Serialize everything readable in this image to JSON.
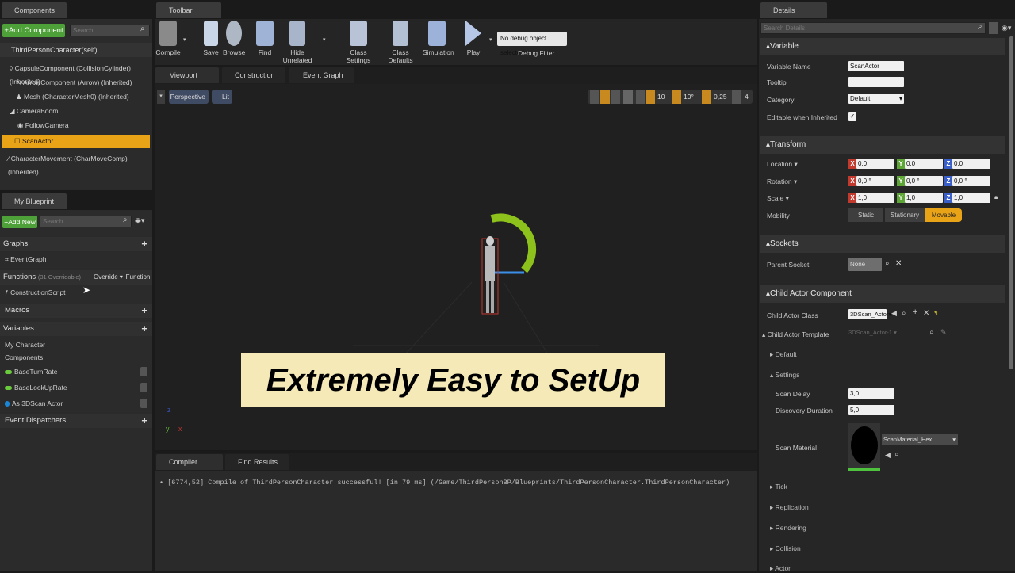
{
  "components": {
    "tab": "Components",
    "add_button": "+Add Component",
    "search_placeholder": "Search",
    "self_label": "ThirdPersonCharacter(self)",
    "items": [
      "CapsuleComponent (CollisionCylinder) (Inherited)",
      "ArrowComponent (Arrow) (Inherited)",
      "Mesh (CharacterMesh0) (Inherited)",
      "CameraBoom",
      "FollowCamera",
      "ScanActor",
      "CharacterMovement (CharMoveComp) (Inherited)"
    ]
  },
  "blueprint": {
    "tab": "My Blueprint",
    "add_new": "+Add New",
    "search_placeholder": "Search",
    "graphs": "Graphs",
    "event_graph": "EventGraph",
    "functions": "Functions",
    "functions_note": "(31 Overridable)",
    "override": "Override",
    "add_function": "+Function",
    "construction_script": "ConstructionScript",
    "macros": "Macros",
    "variables": "Variables",
    "my_character": "My Character",
    "components": "Components",
    "var_items": [
      "BaseTurnRate",
      "BaseLookUpRate",
      "As 3DScan Actor"
    ],
    "event_dispatchers": "Event Dispatchers"
  },
  "toolbar": {
    "tab": "Toolbar",
    "buttons": [
      "Compile",
      "Save",
      "Browse",
      "Find",
      "Hide Unrelated",
      "Class Settings",
      "Class Defaults",
      "Simulation",
      "Play"
    ],
    "debug_select": "No debug object selected",
    "debug_filter": "Debug Filter"
  },
  "editor_tabs": [
    "Viewport",
    "Construction Script",
    "Event Graph"
  ],
  "viewport": {
    "perspective": "Perspective",
    "lit": "Lit",
    "grid_snap": "10",
    "rot_snap": "10°",
    "scale_snap": "0,25",
    "cam_speed": "4",
    "overlay": "Extremely Easy to SetUp"
  },
  "results": {
    "tabs": [
      "Compiler Results",
      "Find Results"
    ],
    "log": "[6774,52] Compile of ThirdPersonCharacter successful! [in 79 ms] (/Game/ThirdPersonBP/Blueprints/ThirdPersonCharacter.ThirdPersonCharacter)"
  },
  "details": {
    "tab": "Details",
    "search_placeholder": "Search Details",
    "variable_section": "Variable",
    "variable_name_label": "Variable Name",
    "variable_name": "ScanActor",
    "tooltip_label": "Tooltip",
    "category_label": "Category",
    "category": "Default",
    "editable_label": "Editable when Inherited",
    "transform_section": "Transform",
    "location_label": "Location",
    "rotation_label": "Rotation",
    "scale_label": "Scale",
    "location": [
      "0,0",
      "0,0",
      "0,0"
    ],
    "rotation": [
      "0,0 °",
      "0,0 °",
      "0,0 °"
    ],
    "scale": [
      "1,0",
      "1,0",
      "1,0"
    ],
    "mobility_label": "Mobility",
    "mobility_options": [
      "Static",
      "Stationary",
      "Movable"
    ],
    "sockets_section": "Sockets",
    "parent_socket_label": "Parent Socket",
    "parent_socket": "None",
    "child_actor_section": "Child Actor Component",
    "child_actor_class_label": "Child Actor Class",
    "child_actor_class": "3DScan_Actor",
    "child_actor_template_label": "Child Actor Template",
    "child_actor_template": "3DScan_Actor-1",
    "default_label": "Default",
    "settings_label": "Settings",
    "scan_delay_label": "Scan Delay",
    "scan_delay": "3,0",
    "discovery_label": "Discovery Duration",
    "discovery": "5,0",
    "scan_material_label": "Scan Material",
    "scan_material": "ScanMaterial_Hex",
    "collapsed": [
      "Tick",
      "Replication",
      "Rendering",
      "Collision",
      "Actor"
    ]
  },
  "colors": {
    "accent": "#e8a317",
    "green": "#6acb3c",
    "banner": "#f5e9b8"
  }
}
